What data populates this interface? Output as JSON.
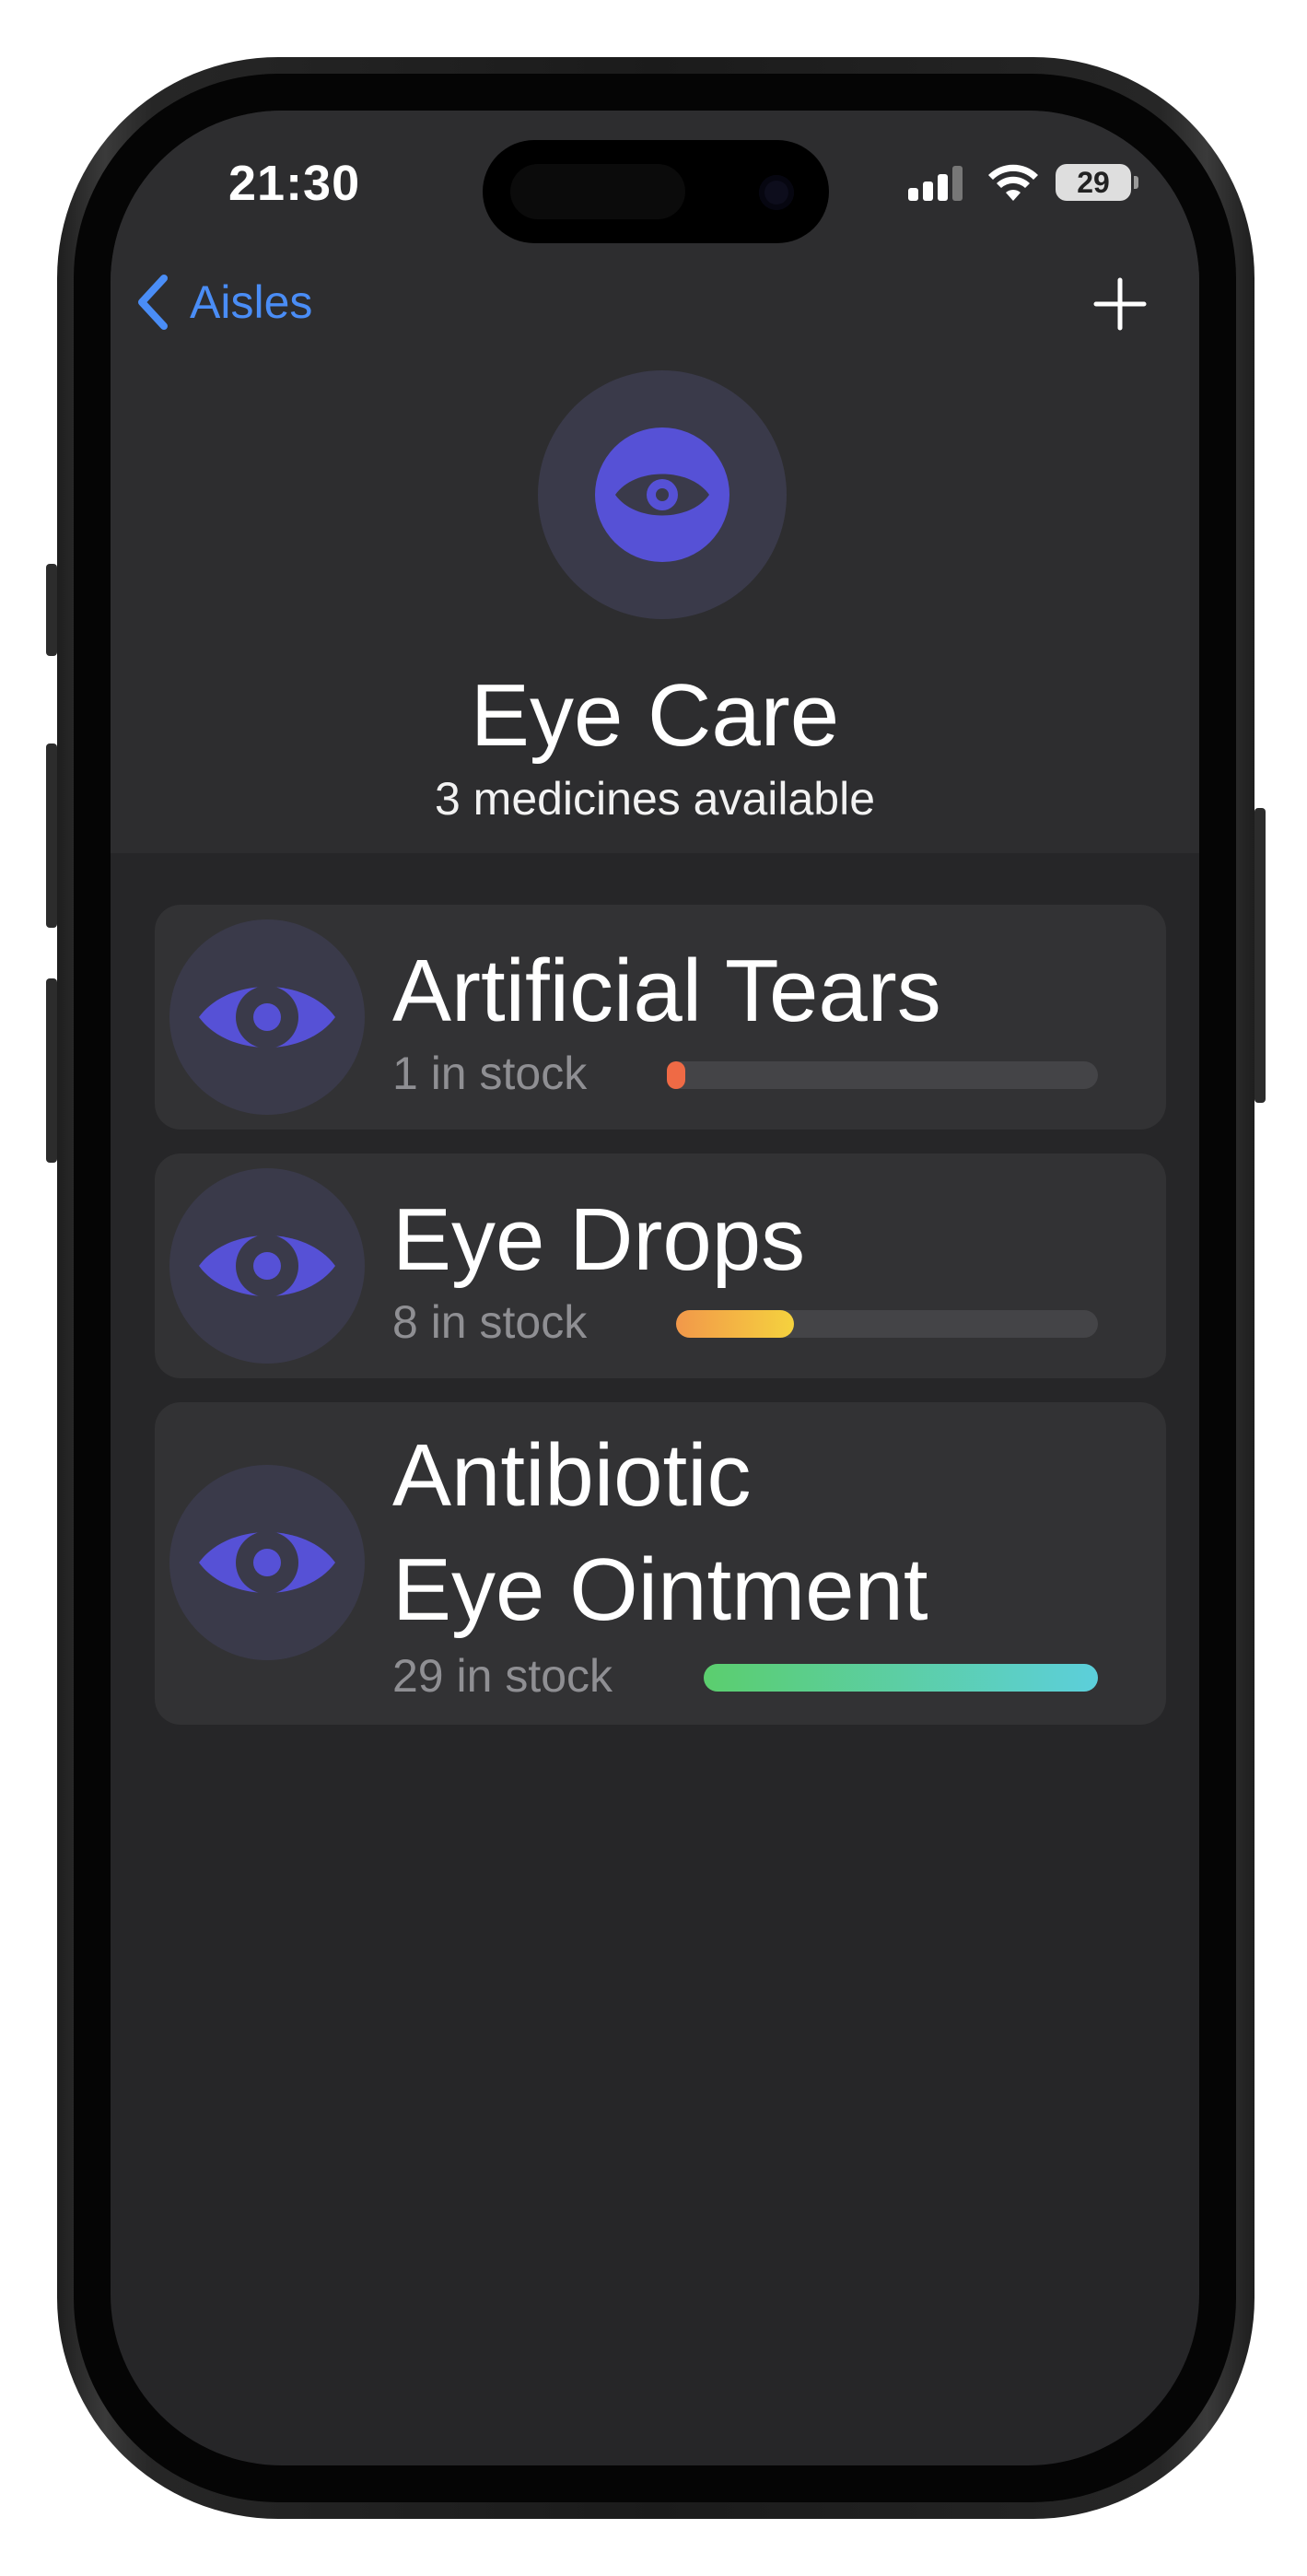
{
  "status_bar": {
    "time": "21:30",
    "battery": "29",
    "icons": [
      "cellular-signal-icon",
      "wifi-icon",
      "battery-icon"
    ]
  },
  "nav": {
    "back_label": "Aisles",
    "back_icon": "chevron-left-icon",
    "add_icon": "plus-icon"
  },
  "header": {
    "icon": "eye-icon",
    "title": "Eye Care",
    "subtitle": "3 medicines available"
  },
  "colors": {
    "accent_blue": "#4a8df6",
    "icon_purple": "#5651d6",
    "icon_bg": "#3a3a4a",
    "low_stock": "#ef6a45",
    "mid_stock_start": "#f2984a",
    "mid_stock_end": "#f5d23e",
    "high_stock_start": "#5bce6e",
    "high_stock_end": "#5ccfdb"
  },
  "medicines": [
    {
      "name": "Artificial Tears",
      "stock_text": "1 in stock",
      "stock_level": 0.03,
      "icon": "eye-icon"
    },
    {
      "name": "Eye Drops",
      "stock_text": "8 in stock",
      "stock_level": 0.28,
      "icon": "eye-icon"
    },
    {
      "name": "Antibiotic\nEye Ointment",
      "name_lines": [
        "Antibiotic",
        "Eye Ointment"
      ],
      "stock_text": "29 in stock",
      "stock_level": 1.0,
      "icon": "eye-icon"
    }
  ]
}
